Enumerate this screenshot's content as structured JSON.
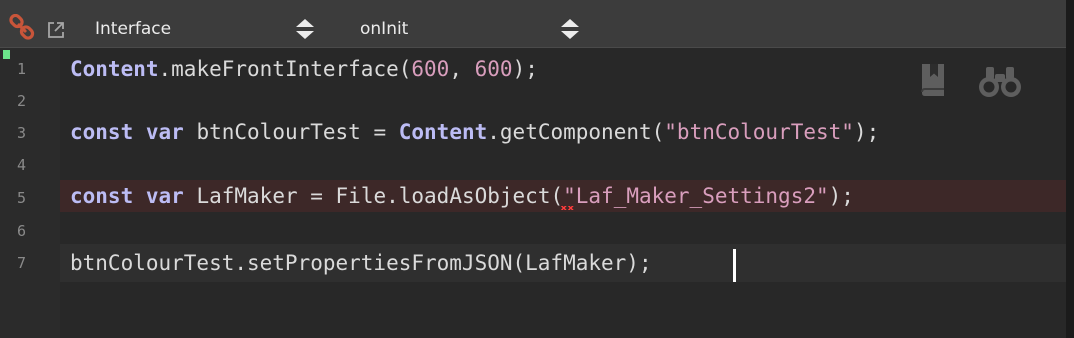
{
  "toolbar": {
    "icons": [
      "link-icon",
      "popout-icon"
    ],
    "file_selector": {
      "value": "Interface"
    },
    "callback_selector": {
      "value": "onInit"
    }
  },
  "editor": {
    "line_numbers": [
      "1",
      "2",
      "3",
      "4",
      "5",
      "6",
      "7"
    ],
    "lines": [
      {
        "tokens": [
          "Content",
          ".makeFrontInterface(",
          "600",
          ", ",
          "600",
          ");"
        ]
      },
      {
        "tokens": []
      },
      {
        "tokens": [
          "const",
          " ",
          "var",
          " btnColourTest = ",
          "Content",
          ".getComponent(",
          "\"btnColourTest\"",
          ");"
        ]
      },
      {
        "tokens": []
      },
      {
        "tokens": [
          "const",
          " ",
          "var",
          " LafMaker = File.loadAsObject(",
          "\"",
          "Laf_Maker_Settings2\"",
          ");"
        ]
      },
      {
        "tokens": []
      },
      {
        "tokens": [
          "btnColourTest.setPropertiesFromJSON(LafMaker);"
        ]
      }
    ],
    "error_line": 5,
    "current_line": 7,
    "side_icons": [
      "bookmark-icon",
      "binoculars-icon"
    ]
  },
  "colors": {
    "background": "#282828",
    "toolbar": "#3c3c3c",
    "keyword": "#bcbcf4",
    "literal": "#d99ebd",
    "error_highlight": "#3d2828",
    "gutter_marker": "#6ce58b",
    "link_icon": "#c8553a"
  }
}
